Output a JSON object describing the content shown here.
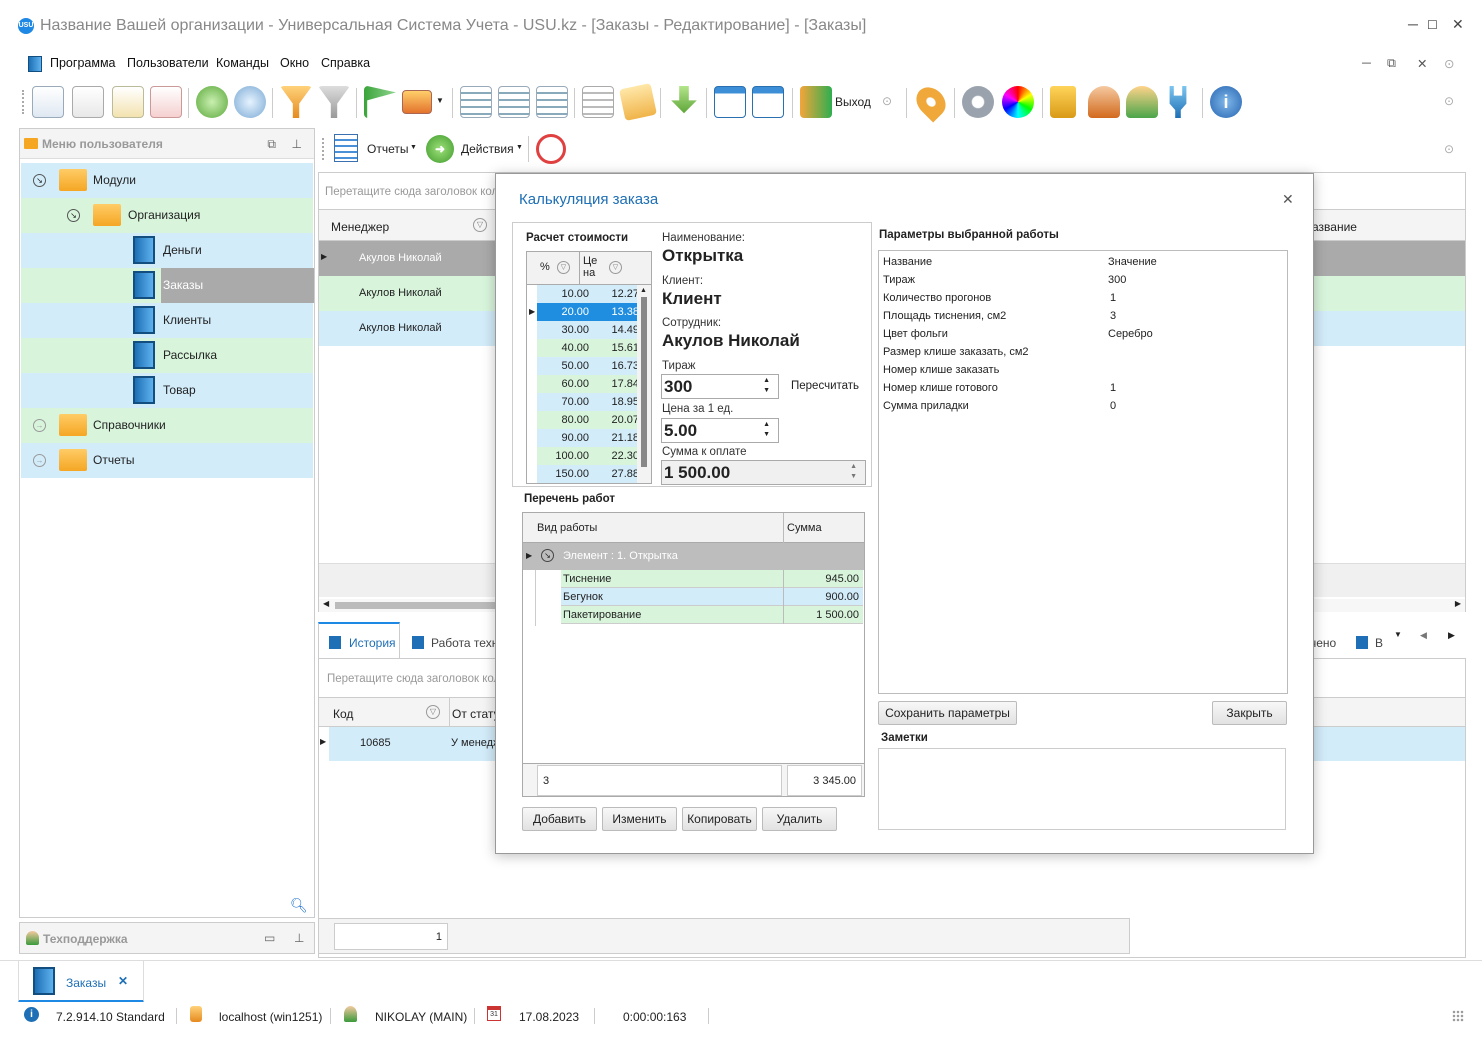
{
  "window": {
    "title": "Название Вашей организации - Универсальная Система Учета - USU.kz - [Заказы - Редактирование] - [Заказы]",
    "logo_text": "USU"
  },
  "menu": [
    "Программа",
    "Пользователи",
    "Команды",
    "Окно",
    "Справка"
  ],
  "toolbar": {
    "exit_label": "Выход"
  },
  "sidebar": {
    "header": "Меню пользователя",
    "items": [
      {
        "label": "Модули"
      },
      {
        "label": "Организация"
      },
      {
        "label": "Деньги"
      },
      {
        "label": "Заказы"
      },
      {
        "label": "Клиенты"
      },
      {
        "label": "Рассылка"
      },
      {
        "label": "Товар"
      },
      {
        "label": "Справочники"
      },
      {
        "label": "Отчеты"
      }
    ],
    "support": "Техподдержка"
  },
  "subtoolbar": {
    "reports": "Отчеты",
    "actions": "Действия"
  },
  "main_grid": {
    "group_hint": "Перетащите сюда заголовок кол",
    "col_manager": "Менеджер",
    "col_name": "азвание",
    "rows": [
      "Акулов Николай",
      "Акулов Николай",
      "Акулов Николай"
    ]
  },
  "bottom": {
    "tab_history": "История",
    "tab_work": "Работа техн",
    "tab_right1": "чено",
    "tab_right2": "В",
    "group_hint": "Перетащите сюда заголовок кол",
    "col_code": "Код",
    "col_status": "От стату",
    "row_code": "10685",
    "row_status": "У менедж",
    "page_num": "1"
  },
  "dialog": {
    "title": "Калькуляция заказа",
    "calc_header": "Расчет стоимости",
    "calc_cols": [
      "%",
      "Це на"
    ],
    "calc_rows": [
      [
        "10.00",
        "12.27"
      ],
      [
        "20.00",
        "13.38"
      ],
      [
        "30.00",
        "14.49"
      ],
      [
        "40.00",
        "15.61"
      ],
      [
        "50.00",
        "16.73"
      ],
      [
        "60.00",
        "17.84"
      ],
      [
        "70.00",
        "18.95"
      ],
      [
        "80.00",
        "20.07"
      ],
      [
        "90.00",
        "21.18"
      ],
      [
        "100.00",
        "22.30"
      ],
      [
        "150.00",
        "27.88"
      ]
    ],
    "name_label": "Наименование:",
    "name_value": "Открытка",
    "client_label": "Клиент:",
    "client_value": "Клиент",
    "employee_label": "Сотрудник:",
    "employee_value": "Акулов Николай",
    "qty_label": "Тираж",
    "qty_value": "300",
    "recalc": "Пересчитать",
    "price_label": "Цена за 1 ед.",
    "price_value": "5.00",
    "sum_label": "Сумма к оплате",
    "sum_value": "1 500.00",
    "works_header": "Перечень работ",
    "works_col1": "Вид работы",
    "works_col2": "Сумма",
    "works_group": "Элемент : 1. Открытка",
    "works": [
      {
        "name": "Тиснение",
        "sum": "945.00"
      },
      {
        "name": "Бегунок",
        "sum": "900.00"
      },
      {
        "name": "Пакетирование",
        "sum": "1 500.00"
      }
    ],
    "works_count": "3",
    "works_total": "3 345.00",
    "btn_add": "Добавить",
    "btn_edit": "Изменить",
    "btn_copy": "Копировать",
    "btn_delete": "Удалить",
    "params_header": "Параметры выбранной работы",
    "params_col1": "Название",
    "params_col2": "Значение",
    "params": [
      {
        "name": "Тираж",
        "value": "300"
      },
      {
        "name": "Количество прогонов",
        "value": "1"
      },
      {
        "name": "Площадь тиснения, см2",
        "value": "3"
      },
      {
        "name": "Цвет фольги",
        "value": "Серебро"
      },
      {
        "name": "Размер клише заказать, см2",
        "value": ""
      },
      {
        "name": "Номер клише заказать",
        "value": ""
      },
      {
        "name": "Номер клише готового",
        "value": "1"
      },
      {
        "name": "Сумма приладки",
        "value": "0"
      }
    ],
    "btn_save_params": "Сохранить параметры",
    "btn_close": "Закрыть",
    "notes_label": "Заметки"
  },
  "taskbar": {
    "tab": "Заказы"
  },
  "status": {
    "version": "7.2.914.10 Standard",
    "server": "localhost (win1251)",
    "user": "NIKOLAY (MAIN)",
    "date": "17.08.2023",
    "timer": "0:00:00:163",
    "calendar_day": "31"
  },
  "colors": {
    "accent": "#1e88e5",
    "row_green": "#d8f5dc",
    "row_blue": "#d2ecfa",
    "selected": "#1f8ee0",
    "group_gray": "#bdbdbd"
  }
}
